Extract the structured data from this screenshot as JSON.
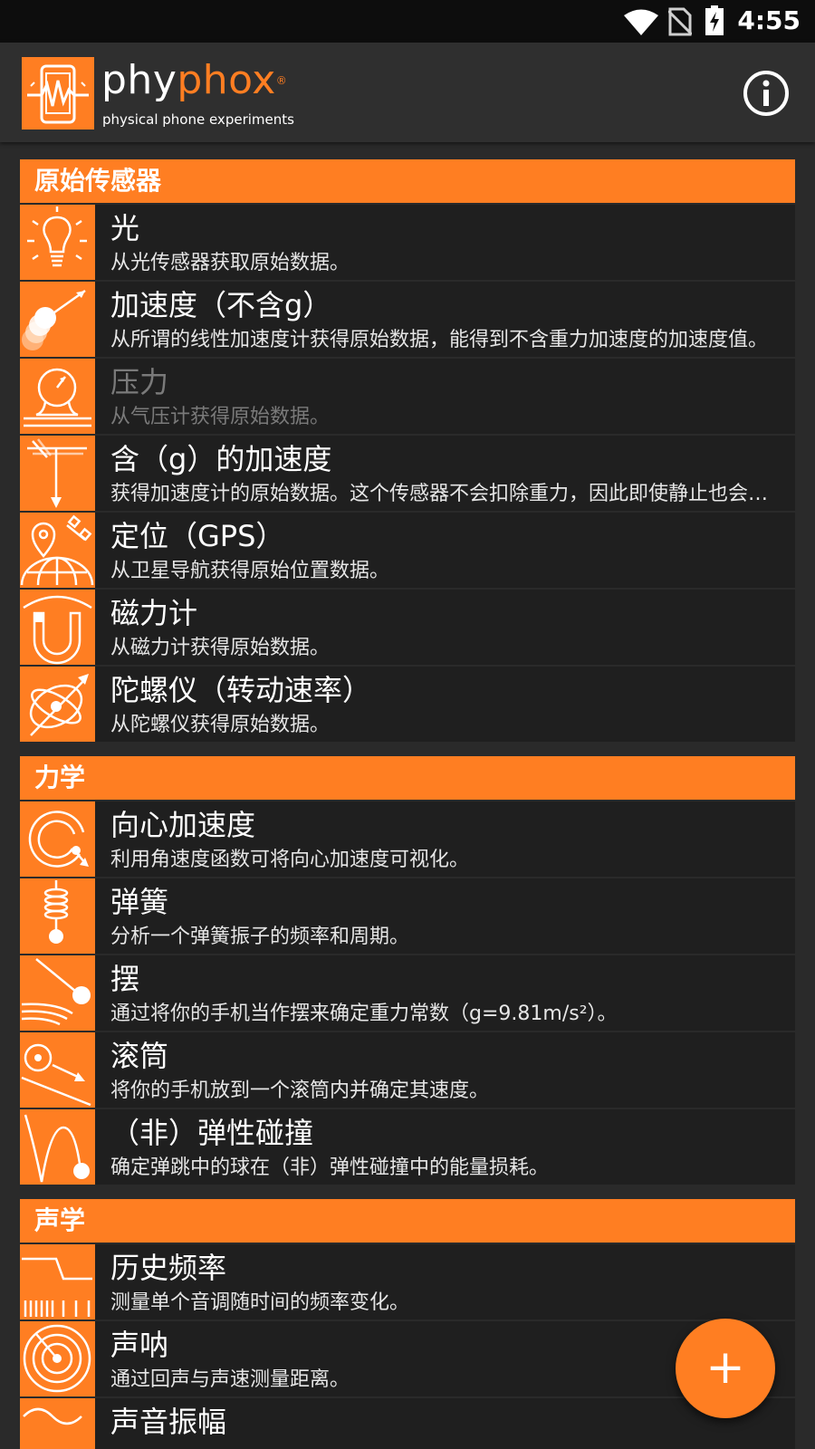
{
  "status_bar": {
    "time": "4:55"
  },
  "app_bar": {
    "logo_text_a": "phy",
    "logo_text_b": "phox",
    "registered": "®",
    "subtitle": "physical phone experiments"
  },
  "sections": [
    {
      "header": "原始传感器",
      "items": [
        {
          "title": "光",
          "desc": "从光传感器获取原始数据。",
          "icon": "light-bulb-icon"
        },
        {
          "title": "加速度（不含g）",
          "desc": "从所谓的线性加速度计获得原始数据，能得到不含重力加速度的加速度值。",
          "icon": "linear-acceleration-icon"
        },
        {
          "title": "压力",
          "desc": "从气压计获得原始数据。",
          "icon": "pressure-gauge-icon",
          "disabled": true
        },
        {
          "title": "含（g）的加速度",
          "desc": "获得加速度计的原始数据。这个传感器不会扣除重力，因此即使静止也会显示重力加速度。",
          "icon": "acceleration-with-g-icon"
        },
        {
          "title": "定位（GPS）",
          "desc": "从卫星导航获得原始位置数据。",
          "icon": "gps-location-icon"
        },
        {
          "title": "磁力计",
          "desc": "从磁力计获得原始数据。",
          "icon": "magnet-icon"
        },
        {
          "title": "陀螺仪（转动速率）",
          "desc": "从陀螺仪获得原始数据。",
          "icon": "gyroscope-icon"
        }
      ]
    },
    {
      "header": "力学",
      "items": [
        {
          "title": "向心加速度",
          "desc": "利用角速度函数可将向心加速度可视化。",
          "icon": "centripetal-icon"
        },
        {
          "title": "弹簧",
          "desc": "分析一个弹簧振子的频率和周期。",
          "icon": "spring-icon"
        },
        {
          "title": "摆",
          "desc": "通过将你的手机当作摆来确定重力常数（g=9.81m/s²）。",
          "icon": "pendulum-icon"
        },
        {
          "title": "滚筒",
          "desc": "将你的手机放到一个滚筒内并确定其速度。",
          "icon": "roll-icon"
        },
        {
          "title": "（非）弹性碰撞",
          "desc": "确定弹跳中的球在（非）弹性碰撞中的能量损耗。",
          "icon": "bouncing-ball-icon"
        }
      ]
    },
    {
      "header": "声学",
      "items": [
        {
          "title": "历史频率",
          "desc": "测量单个音调随时间的频率变化。",
          "icon": "frequency-history-icon"
        },
        {
          "title": "声呐",
          "desc": "通过回声与声速测量距离。",
          "icon": "sonar-icon"
        },
        {
          "title": "声音振幅",
          "desc": "",
          "icon": "audio-amplitude-icon"
        }
      ]
    }
  ],
  "fab": {
    "label": "+"
  },
  "colors": {
    "accent": "#ff7e22",
    "background": "#2a2a2a",
    "item_bg": "#1f1f1f",
    "disabled_text": "#7a7a7a"
  }
}
